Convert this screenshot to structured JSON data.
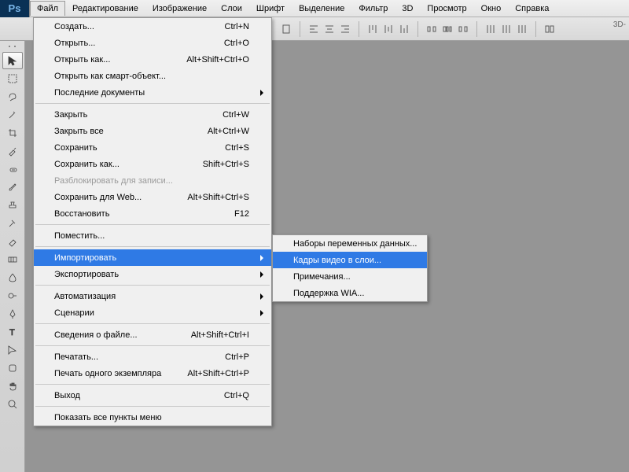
{
  "menubar": {
    "logo": "Ps",
    "items": [
      "Файл",
      "Редактирование",
      "Изображение",
      "Слои",
      "Шрифт",
      "Выделение",
      "Фильтр",
      "3D",
      "Просмотр",
      "Окно",
      "Справка"
    ]
  },
  "right_label": "3D-",
  "file_menu": [
    {
      "label": "Создать...",
      "short": "Ctrl+N"
    },
    {
      "label": "Открыть...",
      "short": "Ctrl+O"
    },
    {
      "label": "Открыть как...",
      "short": "Alt+Shift+Ctrl+O"
    },
    {
      "label": "Открыть как смарт-объект...",
      "short": ""
    },
    {
      "label": "Последние документы",
      "short": "",
      "arrow": true
    },
    {
      "sep": true
    },
    {
      "label": "Закрыть",
      "short": "Ctrl+W"
    },
    {
      "label": "Закрыть все",
      "short": "Alt+Ctrl+W"
    },
    {
      "label": "Сохранить",
      "short": "Ctrl+S"
    },
    {
      "label": "Сохранить как...",
      "short": "Shift+Ctrl+S"
    },
    {
      "label": "Разблокировать для записи...",
      "short": "",
      "disabled": true
    },
    {
      "label": "Сохранить для Web...",
      "short": "Alt+Shift+Ctrl+S"
    },
    {
      "label": "Восстановить",
      "short": "F12"
    },
    {
      "sep": true
    },
    {
      "label": "Поместить...",
      "short": ""
    },
    {
      "sep": true
    },
    {
      "label": "Импортировать",
      "short": "",
      "arrow": true,
      "hl": true
    },
    {
      "label": "Экспортировать",
      "short": "",
      "arrow": true
    },
    {
      "sep": true
    },
    {
      "label": "Автоматизация",
      "short": "",
      "arrow": true
    },
    {
      "label": "Сценарии",
      "short": "",
      "arrow": true
    },
    {
      "sep": true
    },
    {
      "label": "Сведения о файле...",
      "short": "Alt+Shift+Ctrl+I"
    },
    {
      "sep": true
    },
    {
      "label": "Печатать...",
      "short": "Ctrl+P"
    },
    {
      "label": "Печать одного экземпляра",
      "short": "Alt+Shift+Ctrl+P"
    },
    {
      "sep": true
    },
    {
      "label": "Выход",
      "short": "Ctrl+Q"
    },
    {
      "sep": true
    },
    {
      "label": "Показать все пункты меню",
      "short": ""
    }
  ],
  "import_submenu": [
    {
      "label": "Наборы переменных данных..."
    },
    {
      "label": "Кадры видео в слои...",
      "hl": true
    },
    {
      "label": "Примечания..."
    },
    {
      "label": "Поддержка WIA..."
    }
  ]
}
